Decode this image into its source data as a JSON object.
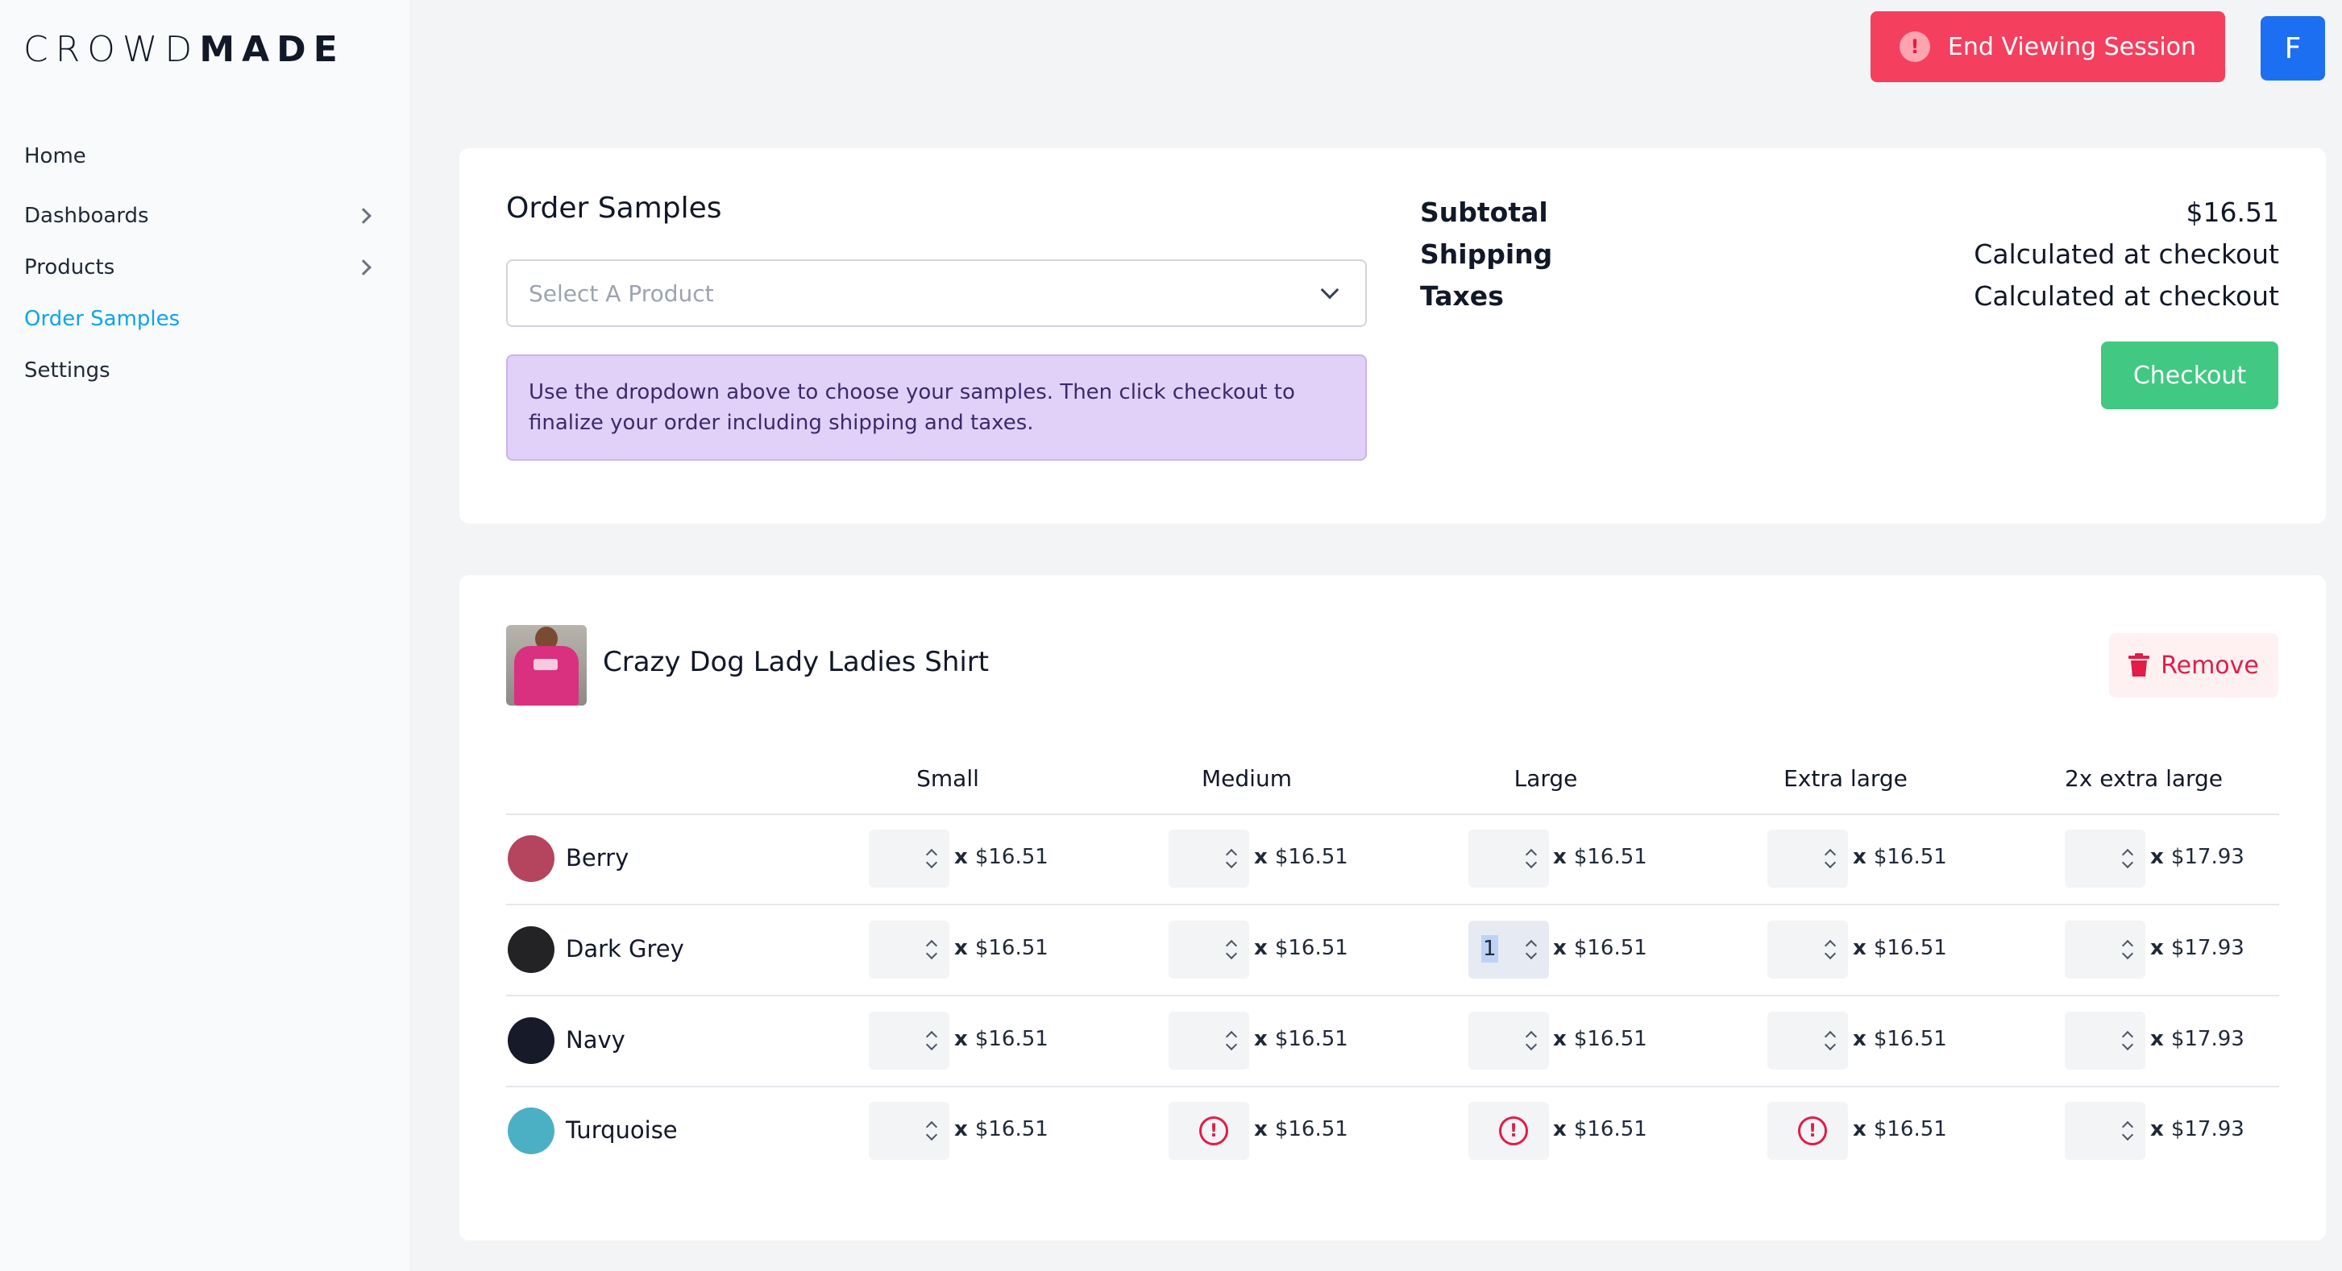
{
  "brand": {
    "light": "CROWD",
    "bold": "MADE"
  },
  "sidebar": {
    "items": [
      {
        "label": "Home",
        "has_children": false,
        "active": false
      },
      {
        "label": "Dashboards",
        "has_children": true,
        "active": false
      },
      {
        "label": "Products",
        "has_children": true,
        "active": false
      },
      {
        "label": "Order Samples",
        "has_children": false,
        "active": true
      },
      {
        "label": "Settings",
        "has_children": false,
        "active": false
      }
    ]
  },
  "topbar": {
    "end_session_label": "End Viewing Session",
    "end_session_icon": "!",
    "avatar_initial": "F"
  },
  "order": {
    "title": "Order Samples",
    "select_placeholder": "Select A Product",
    "info_text": "Use the dropdown above to choose your samples. Then click checkout to finalize your order including shipping and taxes.",
    "summary": [
      {
        "label": "Subtotal",
        "value": "$16.51"
      },
      {
        "label": "Shipping",
        "value": "Calculated at checkout"
      },
      {
        "label": "Taxes",
        "value": "Calculated at checkout"
      }
    ],
    "checkout_label": "Checkout"
  },
  "product": {
    "name": "Crazy Dog Lady Ladies Shirt",
    "remove_label": "Remove",
    "sizes": [
      "Small",
      "Medium",
      "Large",
      "Extra large",
      "2x extra large"
    ],
    "rows": [
      {
        "color": "Berry",
        "swatch": "#b5445f",
        "cells": [
          {
            "state": "spinner",
            "value": "",
            "price": "$16.51"
          },
          {
            "state": "spinner",
            "value": "",
            "price": "$16.51"
          },
          {
            "state": "spinner",
            "value": "",
            "price": "$16.51"
          },
          {
            "state": "spinner",
            "value": "",
            "price": "$16.51"
          },
          {
            "state": "spinner",
            "value": "",
            "price": "$17.93"
          }
        ]
      },
      {
        "color": "Dark Grey",
        "swatch": "#232326",
        "cells": [
          {
            "state": "spinner",
            "value": "",
            "price": "$16.51"
          },
          {
            "state": "spinner",
            "value": "",
            "price": "$16.51"
          },
          {
            "state": "spinner",
            "value": "1",
            "price": "$16.51"
          },
          {
            "state": "spinner",
            "value": "",
            "price": "$16.51"
          },
          {
            "state": "spinner",
            "value": "",
            "price": "$17.93"
          }
        ]
      },
      {
        "color": "Navy",
        "swatch": "#171a29",
        "cells": [
          {
            "state": "spinner",
            "value": "",
            "price": "$16.51"
          },
          {
            "state": "spinner",
            "value": "",
            "price": "$16.51"
          },
          {
            "state": "spinner",
            "value": "",
            "price": "$16.51"
          },
          {
            "state": "spinner",
            "value": "",
            "price": "$16.51"
          },
          {
            "state": "spinner",
            "value": "",
            "price": "$17.93"
          }
        ]
      },
      {
        "color": "Turquoise",
        "swatch": "#4bb0c4",
        "cells": [
          {
            "state": "spinner",
            "value": "",
            "price": "$16.51"
          },
          {
            "state": "error",
            "value": "",
            "price": "$16.51"
          },
          {
            "state": "error",
            "value": "",
            "price": "$16.51"
          },
          {
            "state": "error",
            "value": "",
            "price": "$16.51"
          },
          {
            "state": "spinner",
            "value": "",
            "price": "$17.93"
          }
        ]
      }
    ]
  },
  "colors": {
    "accent": "#0ea5e9",
    "danger": "#f43f5e",
    "success": "#41c882",
    "info_bg": "#e1d1f9"
  }
}
